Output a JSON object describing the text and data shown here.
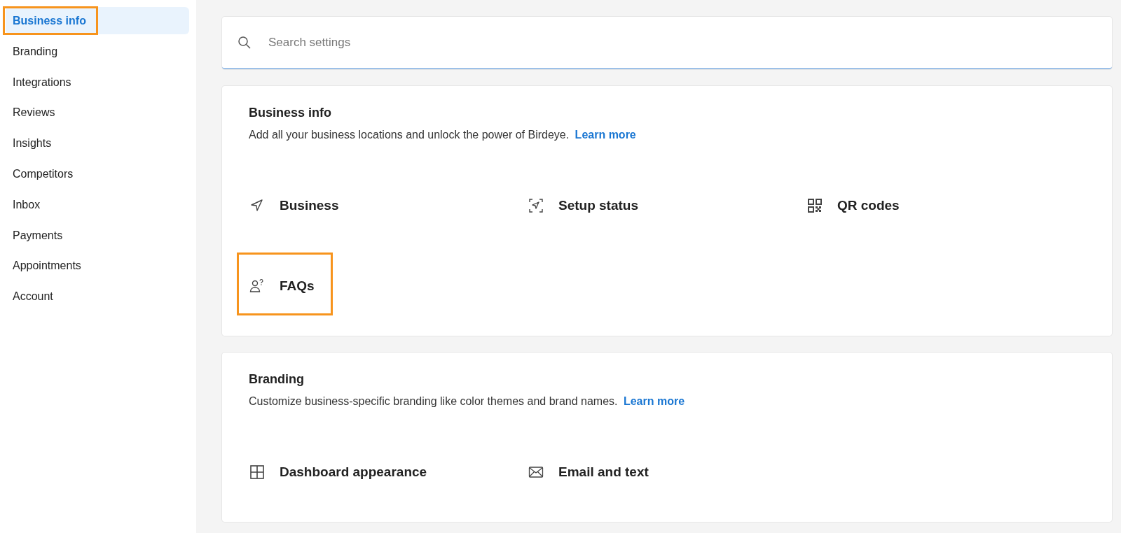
{
  "sidebar": {
    "items": [
      {
        "label": "Business info",
        "selected": true,
        "highlighted": true
      },
      {
        "label": "Branding",
        "selected": false,
        "highlighted": false
      },
      {
        "label": "Integrations",
        "selected": false,
        "highlighted": false
      },
      {
        "label": "Reviews",
        "selected": false,
        "highlighted": false
      },
      {
        "label": "Insights",
        "selected": false,
        "highlighted": false
      },
      {
        "label": "Competitors",
        "selected": false,
        "highlighted": false
      },
      {
        "label": "Inbox",
        "selected": false,
        "highlighted": false
      },
      {
        "label": "Payments",
        "selected": false,
        "highlighted": false
      },
      {
        "label": "Appointments",
        "selected": false,
        "highlighted": false
      },
      {
        "label": "Account",
        "selected": false,
        "highlighted": false
      }
    ]
  },
  "search": {
    "placeholder": "Search settings"
  },
  "sections": [
    {
      "title": "Business info",
      "description": "Add all your business locations and unlock the power of Birdeye.",
      "link": "Learn more",
      "tiles": [
        {
          "label": "Business",
          "highlighted": false
        },
        {
          "label": "Setup status",
          "highlighted": false
        },
        {
          "label": "QR codes",
          "highlighted": false
        },
        {
          "label": "FAQs",
          "highlighted": true
        }
      ]
    },
    {
      "title": "Branding",
      "description": "Customize business-specific branding like color themes and brand names.",
      "link": "Learn more",
      "tiles": [
        {
          "label": "Dashboard appearance",
          "highlighted": false
        },
        {
          "label": "Email and text",
          "highlighted": false
        }
      ]
    }
  ]
}
